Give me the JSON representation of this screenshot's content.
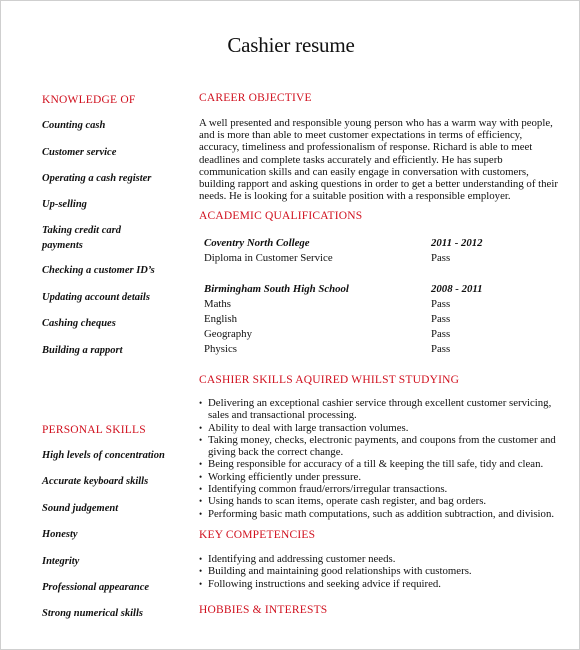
{
  "title": "Cashier resume",
  "colors": {
    "heading_red": "#d0101e",
    "text": "#111111",
    "border": "#cfcfcf"
  },
  "left": {
    "knowledge": {
      "heading": "KNOWLEDGE OF",
      "items": [
        "Counting cash",
        "Customer service",
        "Operating a cash register",
        "Up-selling",
        "Taking credit card payments",
        "Checking a customer ID’s",
        "Updating account details",
        "Cashing cheques",
        "Building a rapport"
      ]
    },
    "personal": {
      "heading": "PERSONAL SKILLS",
      "items": [
        "High levels of concentration",
        "Accurate keyboard skills",
        "Sound judgement",
        "Honesty",
        "Integrity",
        "Professional appearance",
        "Strong numerical skills"
      ]
    }
  },
  "career": {
    "heading": "CAREER OBJECTIVE",
    "text": "A well presented and responsible young person who has a warm way with people, and is more than able to meet customer expectations in terms of efficiency, accuracy, timeliness and professionalism of response. Richard is able to meet deadlines and complete tasks accurately and efficiently. He has superb communication skills and can easily engage in conversation with customers, building rapport and asking questions in order to get a better understanding of their needs. He is looking for a suitable position with a responsible employer."
  },
  "academic": {
    "heading": "ACADEMIC QUALIFICATIONS",
    "schools": [
      {
        "name": "Coventry North College",
        "years": "2011 - 2012",
        "subjects": [
          {
            "subject": "Diploma in Customer Service",
            "result": "Pass"
          }
        ]
      },
      {
        "name": "Birmingham South High School",
        "years": "2008 - 2011",
        "subjects": [
          {
            "subject": "Maths",
            "result": "Pass"
          },
          {
            "subject": "English",
            "result": "Pass"
          },
          {
            "subject": "Geography",
            "result": "Pass"
          },
          {
            "subject": "Physics",
            "result": "Pass"
          }
        ]
      }
    ]
  },
  "cashier_skills": {
    "heading": "CASHIER SKILLS AQUIRED WHILST STUDYING",
    "bullet": "•",
    "items": [
      "Delivering an exceptional cashier service through excellent customer servicing, sales and transactional processing.",
      "Ability to deal with large transaction volumes.",
      "Taking money, checks, electronic payments, and coupons from the customer and giving back the correct change.",
      "Being responsible for accuracy of a till & keeping the till safe, tidy and clean.",
      "Working efficiently under pressure.",
      "Identifying common fraud/errors/irregular transactions.",
      "Using hands to scan items, operate cash register, and bag orders.",
      "Performing basic math computations, such as addition subtraction, and division."
    ]
  },
  "key_competencies": {
    "heading": "KEY COMPETENCIES",
    "bullet": "•",
    "items": [
      "Identifying and addressing customer needs.",
      "Building and maintaining good relationships with customers.",
      "Following instructions and seeking advice if required."
    ]
  },
  "hobbies": {
    "heading": "HOBBIES & INTERESTS"
  }
}
